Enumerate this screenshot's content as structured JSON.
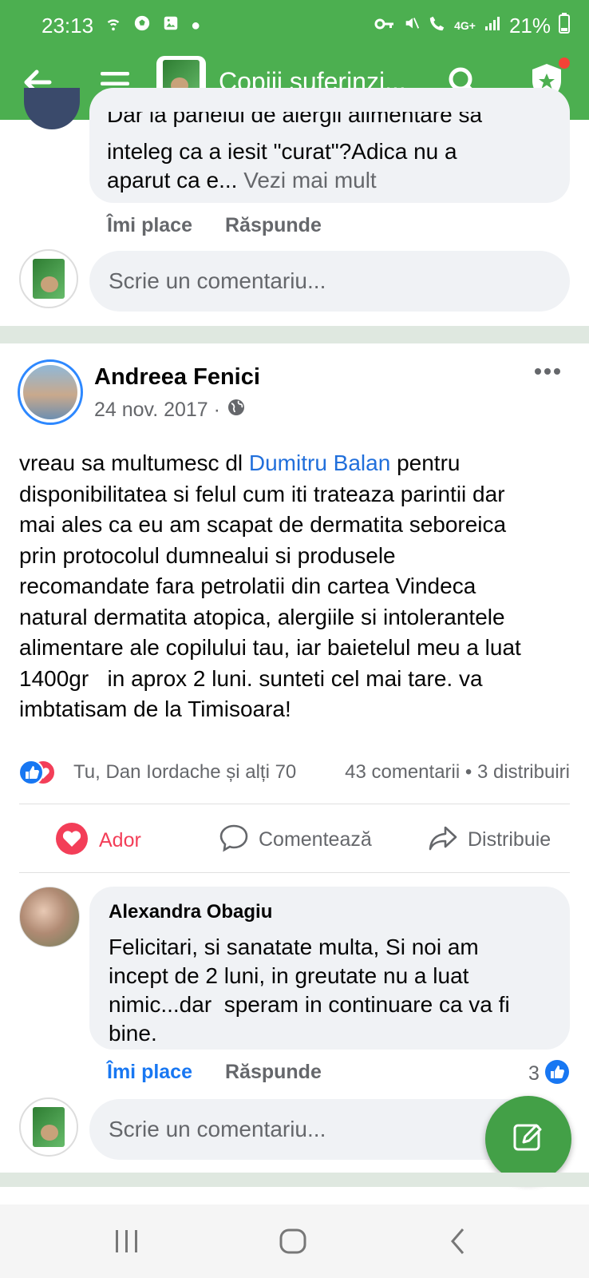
{
  "status": {
    "time": "23:13",
    "network": "4G+",
    "battery": "21%"
  },
  "header": {
    "title": "Copiii suferinzi..."
  },
  "prev_comment": {
    "line1": "Dar la panelul de alergii alimentare sa",
    "line2": "inteleg ca a iesit \"curat\"?Adica nu a",
    "line3_text": "aparut ca e...",
    "see_more": "Vezi mai mult",
    "like_label": "Îmi place",
    "reply_label": "Răspunde"
  },
  "composer_top": {
    "placeholder": "Scrie un comentariu..."
  },
  "post": {
    "author": "Andreea Fenici",
    "date": "24 nov. 2017 ·",
    "body_lines": [
      "vreau sa multumesc dl",
      "Dumitru Balan",
      "pentru",
      "disponibilitatea si felul cum iti trateaza parintii dar",
      "mai ales ca eu am scapat de dermatita seboreica",
      "prin protocolul dumnealui si produsele",
      "recomandate fara petrolatii din cartea Vindeca",
      "natural dermatita atopica, alergiile si intolerantele",
      "alimentare ale copilului tau, iar baietelul meu a luat",
      "1400gr   in aprox 2 luni. sunteti cel mai tare. va",
      "imbtatisam de la Timisoara!"
    ],
    "reactions_text": "Tu, Dan Iordache și alți 70",
    "comments_count": "43 comentarii",
    "shares_sep": "•",
    "shares_count": "3 distribuiri",
    "actions": {
      "love": "Ador",
      "comment": "Comentează",
      "share": "Distribuie"
    }
  },
  "reply": {
    "author": "Alexandra Obagiu",
    "lines": [
      "Felicitari, si sanatate multa, Si noi am",
      "incept de 2 luni, in greutate nu a luat",
      "nimic...dar  speram in continuare ca va fi",
      "bine."
    ],
    "like_label": "Îmi place",
    "reply_label": "Răspunde",
    "like_count": "3"
  },
  "composer_bottom": {
    "placeholder": "Scrie un comentariu..."
  },
  "colors": {
    "brand_green": "#4caf50",
    "fab_green": "#43a047",
    "link_blue": "#216fdb",
    "like_blue": "#1877f2",
    "love_red": "#f33e58"
  }
}
